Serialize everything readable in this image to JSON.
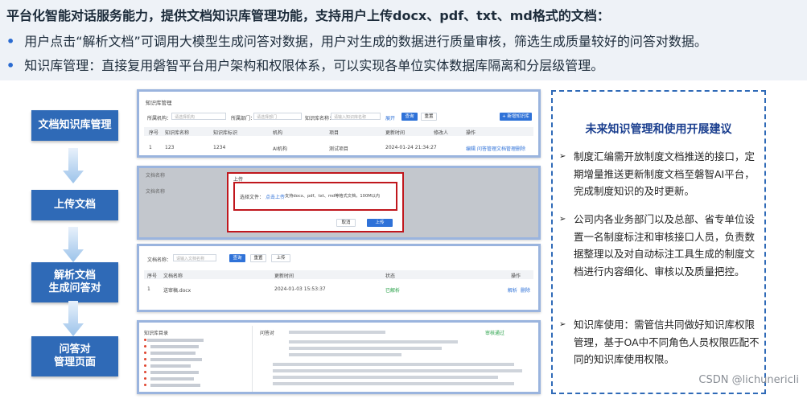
{
  "header": {
    "title": "平台化智能对话服务能力，提供文档知识库管理功能，支持用户上传docx、pdf、txt、md格式的文档：",
    "bullets": [
      "用户点击“解析文档”可调用大模型生成问答对数据，用户对生成的数据进行质量审核，筛选生成质量较好的问答对数据。",
      "知识库管理：直接复用磐智平台用户架构和权限体系，可以实现各单位实体数据库隔离和分层级管理。"
    ]
  },
  "flow": {
    "steps": [
      "文档知识库管理",
      "上传文档",
      "解析文档\n生成问答对",
      "问答对\n管理页面"
    ]
  },
  "panel1": {
    "title": "知识库管理",
    "filters": [
      "所属机构：",
      "所属部门：",
      "知识库名称："
    ],
    "filter_placeholders": [
      "请选择机构",
      "请选择部门",
      "请输入知识库名称"
    ],
    "expand": "展开",
    "query": "查询",
    "reset": "重置",
    "add": "+ 新增知识库",
    "columns": [
      "序号",
      "知识库名称",
      "知识库标识",
      "机构",
      "项目",
      "更新时间",
      "修改人",
      "操作"
    ],
    "row": [
      "1",
      "123",
      "1234",
      "AI机构",
      "测试项目",
      "2024-01-24 21:34:27",
      ""
    ],
    "actions": [
      "编辑",
      "问答管理",
      "文档管理",
      "删除"
    ]
  },
  "panel2": {
    "bg_label": "文档名称",
    "bg_label2": "文档名称",
    "modal_title": "上传",
    "modal_field": "选择文件：",
    "modal_link": "点击上传",
    "modal_hint": "支持docx、pdf、txt、md等格式文档，100M以内",
    "cancel": "取消",
    "upload": "上传"
  },
  "panel3": {
    "filter_label": "文档名称：",
    "filter_placeholder": "请输入文档名称",
    "query": "查询",
    "reset": "重置",
    "upload": "上传",
    "columns": [
      "序号",
      "文档名称",
      "更新时间",
      "状态",
      "操作"
    ],
    "row": [
      "1",
      "送审稿.docx",
      "2024-01-03 15:53:37",
      "已解析",
      ""
    ],
    "actions": [
      "解析",
      "删除"
    ]
  },
  "panel4": {
    "tree_title": "知识库目录",
    "qa_hint": "问答对",
    "status": "审核通过"
  },
  "right_panel": {
    "title": "未来知识管理和使用开展建议",
    "items": [
      "制度汇编需开放制度文档推送的接口，定期增量推送更新制度文档至磐智AI平台，完成制度知识的及时更新。",
      "公司内各业务部门以及总部、省专单位设置一名制度标注和审核接口人员，负责数据整理以及对自动标注工具生成的制度文档进行内容细化、审核以及质量把控。",
      "知识库使用：需管信共同做好知识库权限管理，基于OA中不同角色人员权限匹配不同的知识库使用权限。"
    ]
  },
  "watermark": "CSDN @lichunericli",
  "colors": {
    "accent": "#2f6ab7",
    "highlight_red": "#c0171d",
    "title_blue": "#1b3f8f"
  }
}
